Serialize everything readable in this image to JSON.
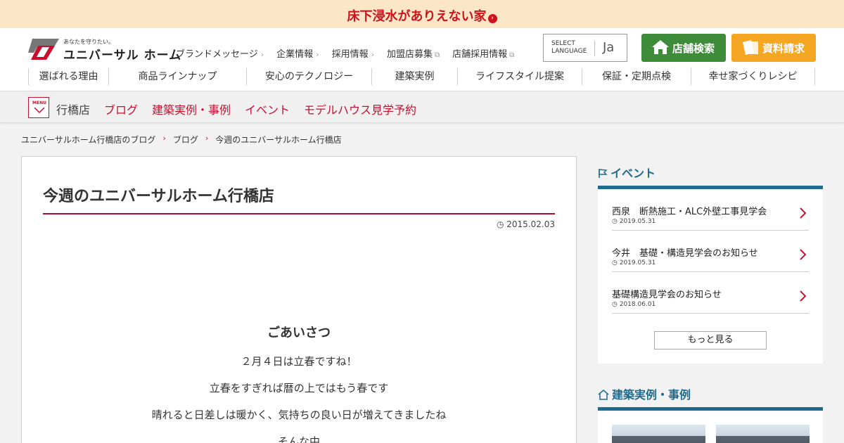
{
  "banner": {
    "text": "床下浸水がありえない家"
  },
  "header": {
    "logo_tagline": "あなたを守りたい。",
    "logo_name": "ユニバーサル ホーム",
    "util_nav": [
      {
        "label": "ブランドメッセージ"
      },
      {
        "label": "企業情報"
      },
      {
        "label": "採用情報"
      },
      {
        "label": "加盟店募集"
      },
      {
        "label": "店舗採用情報"
      }
    ],
    "language": {
      "select_label_1": "SELECT",
      "select_label_2": "LANGUAGE",
      "current": "Ja"
    },
    "store_search_label": "店舗検索",
    "request_docs_label": "資料請求",
    "main_nav": [
      {
        "label": "選ばれる理由"
      },
      {
        "label": "商品ラインナップ"
      },
      {
        "label": "安心のテクノロジー"
      },
      {
        "label": "建築実例"
      },
      {
        "label": "ライフスタイル提案"
      },
      {
        "label": "保証・定期点検"
      },
      {
        "label": "幸せ家づくりレシピ"
      }
    ]
  },
  "subbar": {
    "menu_label": "MENU",
    "store_name": "行橋店",
    "links": [
      {
        "label": "ブログ"
      },
      {
        "label": "建築実例・事例"
      },
      {
        "label": "イベント"
      },
      {
        "label": "モデルハウス見学予約"
      }
    ]
  },
  "breadcrumb": [
    {
      "label": "ユニバーサルホーム行橋店のブログ"
    },
    {
      "label": "ブログ"
    },
    {
      "label": "今週のユニバーサルホーム行橋店"
    }
  ],
  "article": {
    "title": "今週のユニバーサルホーム行橋店",
    "date": "2015.02.03",
    "heading": "ごあいさつ",
    "lines": [
      "２月４日は立春ですね！",
      "立春をすぎれば暦の上ではもう春です",
      "晴れると日差しは暖かく、気持ちの良い日が増えてきましたね",
      "そんな中"
    ]
  },
  "sidebar": {
    "events_title": "イベント",
    "events": [
      {
        "title": "西泉　断熱施工・ALC外壁工事見学会",
        "date": "2019.05.31"
      },
      {
        "title": "今井　基礎・構造見学会のお知らせ",
        "date": "2019.05.31"
      },
      {
        "title": "基礎構造見学会のお知らせ",
        "date": "2018.06.01"
      }
    ],
    "more_label": "もっと見る",
    "cases_title": "建築実例・事例"
  },
  "colors": {
    "brand_red": "#c8102e",
    "accent_blue": "#1d6b8f",
    "green": "#3e8b3a",
    "orange": "#f5a623",
    "banner_bg": "#fce6c8"
  }
}
